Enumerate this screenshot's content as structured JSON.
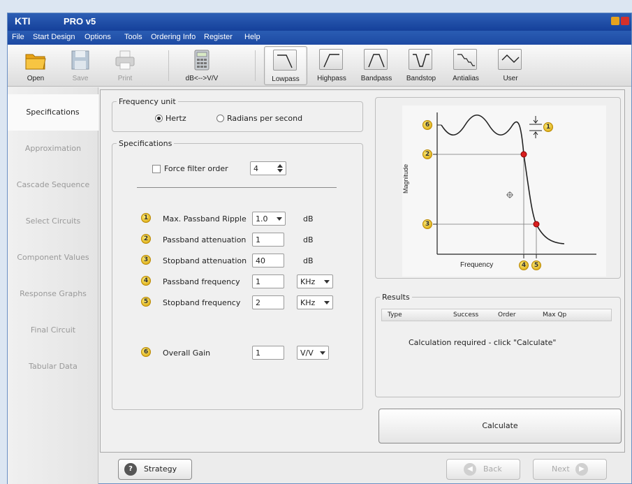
{
  "window": {
    "app_name": "KTI",
    "version": "PRO v5"
  },
  "menu": [
    "File",
    "Start Design",
    "Options",
    "Tools",
    "Ordering Info",
    "Register",
    "Help"
  ],
  "toolbar": {
    "open": "Open",
    "save": "Save",
    "print": "Print",
    "convert": "dB<-->V/V",
    "lowpass": "Lowpass",
    "highpass": "Highpass",
    "bandpass": "Bandpass",
    "bandstop": "Bandstop",
    "antialias": "Antialias",
    "user": "User",
    "selected": "Lowpass"
  },
  "sidebar": [
    "Specifications",
    "Approximation",
    "Cascade Sequence",
    "Select Circuits",
    "Component Values",
    "Response Graphs",
    "Final Circuit",
    "Tabular Data"
  ],
  "freq_unit": {
    "legend": "Frequency unit",
    "hertz": "Hertz",
    "radians": "Radians per second",
    "selected": "Hertz"
  },
  "specs": {
    "legend": "Specifications",
    "force_label": "Force filter order",
    "force_checked": false,
    "order_value": "4",
    "rows": [
      {
        "num": "1",
        "label": "Max. Passband Ripple",
        "value": "1.0",
        "unit": "dB"
      },
      {
        "num": "2",
        "label": "Passband attenuation",
        "value": "1",
        "unit": "dB"
      },
      {
        "num": "3",
        "label": "Stopband attenuation",
        "value": "40",
        "unit": "dB"
      },
      {
        "num": "4",
        "label": "Passband frequency",
        "value": "1",
        "unit": "KHz"
      },
      {
        "num": "5",
        "label": "Stopband frequency",
        "value": "2",
        "unit": "KHz"
      },
      {
        "num": "6",
        "label": "Overall Gain",
        "value": "1",
        "unit": "V/V"
      }
    ]
  },
  "diagram": {
    "ylabel": "Magnitude",
    "xlabel": "Frequency",
    "markers": [
      "6",
      "2",
      "3",
      "1",
      "4",
      "5"
    ]
  },
  "results": {
    "legend": "Results",
    "headers": [
      "Type",
      "Success",
      "Order",
      "Max Qp"
    ],
    "message": "Calculation required - click \"Calculate\""
  },
  "buttons": {
    "calculate": "Calculate",
    "strategy": "Strategy",
    "back": "Back",
    "next": "Next"
  },
  "colors": {
    "title_bar": "#15409a",
    "marker_red": "#d81e1e",
    "marker_yellow": "#f2c200"
  }
}
